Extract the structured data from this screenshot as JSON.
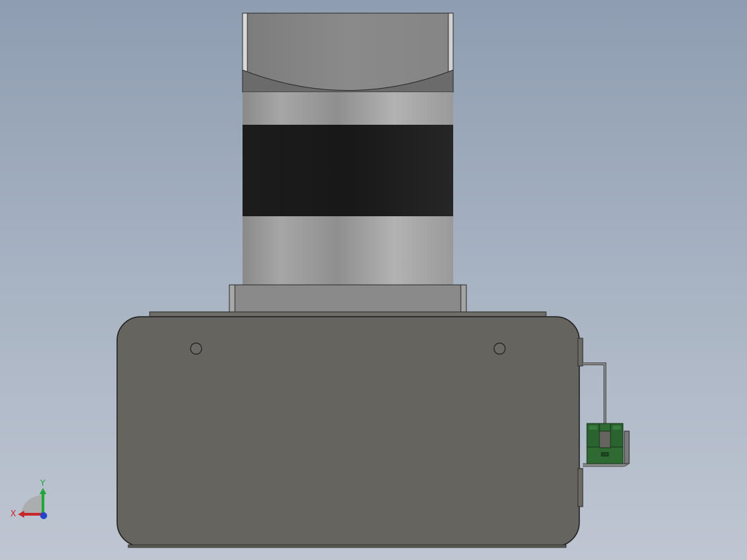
{
  "viewport": {
    "background_top": "#8e9db1",
    "background_bottom": "#bfc6d2"
  },
  "model": {
    "parts": [
      "motor-cap",
      "motor-body",
      "motor-band",
      "motor-flange",
      "base-housing",
      "mounting-hole-left",
      "mounting-hole-right",
      "sensor-bracket",
      "photo-sensor"
    ],
    "colors": {
      "housing": "#65645f",
      "band": "#1b1b1b",
      "sensor": "#2e6a32",
      "outline": "#2a2a2a"
    }
  },
  "triad": {
    "x_label": "X",
    "y_label": "Y",
    "x_color": "#c8262a",
    "y_color": "#23a63a",
    "z_color": "#2445c8"
  }
}
